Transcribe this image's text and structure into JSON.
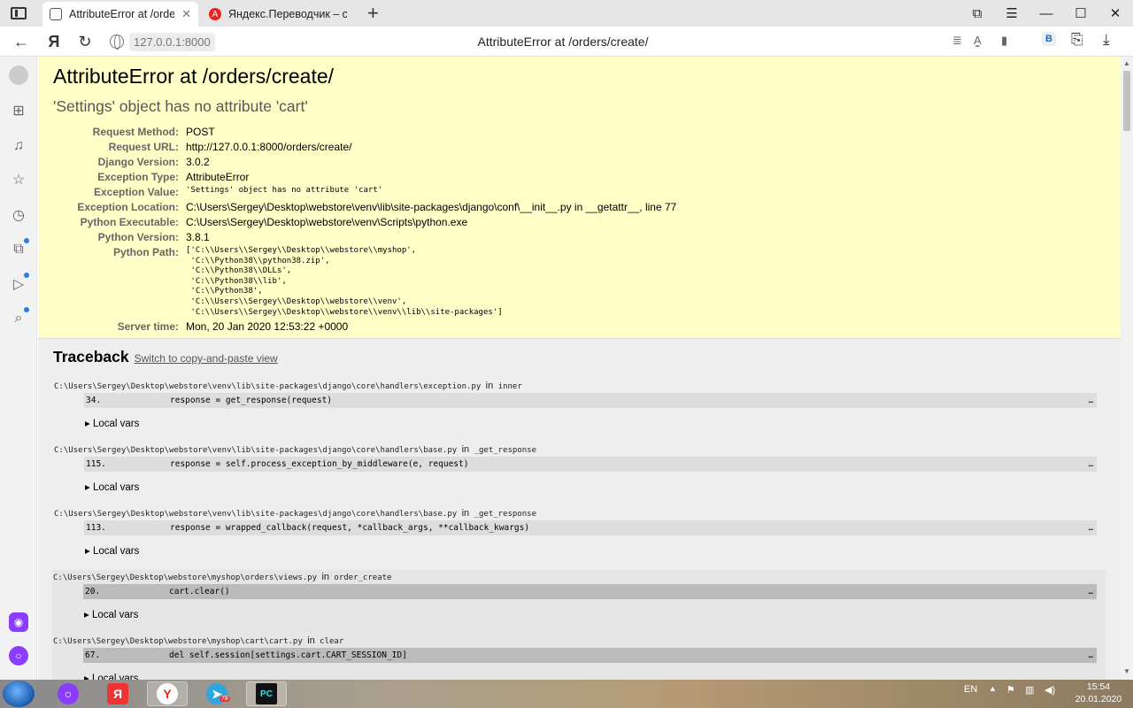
{
  "browser": {
    "tabs": [
      {
        "title": "AttributeError at /orders/",
        "active": true
      },
      {
        "title": "Яндекс.Переводчик – слов",
        "active": false
      }
    ],
    "url_host": "127.0.0.1:8000",
    "page_title": "AttributeError at /orders/create/"
  },
  "error": {
    "title": "AttributeError at /orders/create/",
    "subtitle": "'Settings' object has no attribute 'cart'",
    "meta": [
      {
        "label": "Request Method:",
        "value": "POST"
      },
      {
        "label": "Request URL:",
        "value": "http://127.0.0.1:8000/orders/create/"
      },
      {
        "label": "Django Version:",
        "value": "3.0.2"
      },
      {
        "label": "Exception Type:",
        "value": "AttributeError"
      },
      {
        "label": "Exception Value:",
        "value": "'Settings' object has no attribute 'cart'"
      },
      {
        "label": "Exception Location:",
        "value": "C:\\Users\\Sergey\\Desktop\\webstore\\venv\\lib\\site-packages\\django\\conf\\__init__.py in __getattr__, line 77"
      },
      {
        "label": "Python Executable:",
        "value": "C:\\Users\\Sergey\\Desktop\\webstore\\venv\\Scripts\\python.exe"
      },
      {
        "label": "Python Version:",
        "value": "3.8.1"
      },
      {
        "label": "Python Path:",
        "value": "['C:\\\\Users\\\\Sergey\\\\Desktop\\\\webstore\\\\myshop',\n 'C:\\\\Python38\\\\python38.zip',\n 'C:\\\\Python38\\\\DLLs',\n 'C:\\\\Python38\\\\lib',\n 'C:\\\\Python38',\n 'C:\\\\Users\\\\Sergey\\\\Desktop\\\\webstore\\\\venv',\n 'C:\\\\Users\\\\Sergey\\\\Desktop\\\\webstore\\\\venv\\\\lib\\\\site-packages']"
      },
      {
        "label": "Server time:",
        "value": "Mon, 20 Jan 2020 12:53:22 +0000"
      }
    ]
  },
  "traceback": {
    "heading": "Traceback",
    "switch_link": "Switch to copy-and-paste view",
    "in_word": "in",
    "local_vars": "▸ Local vars",
    "ellipsis": "…",
    "frames": [
      {
        "path": "C:\\Users\\Sergey\\Desktop\\webstore\\venv\\lib\\site-packages\\django\\core\\handlers\\exception.py",
        "func": "inner",
        "line": "34.",
        "code": "response = get_response(request)"
      },
      {
        "path": "C:\\Users\\Sergey\\Desktop\\webstore\\venv\\lib\\site-packages\\django\\core\\handlers\\base.py",
        "func": "_get_response",
        "line": "115.",
        "code": "response = self.process_exception_by_middleware(e, request)"
      },
      {
        "path": "C:\\Users\\Sergey\\Desktop\\webstore\\venv\\lib\\site-packages\\django\\core\\handlers\\base.py",
        "func": "_get_response",
        "line": "113.",
        "code": "response = wrapped_callback(request, *callback_args, **callback_kwargs)"
      },
      {
        "path": "C:\\Users\\Sergey\\Desktop\\webstore\\myshop\\orders\\views.py",
        "func": "order_create",
        "line": "20.",
        "code": "cart.clear()"
      },
      {
        "path": "C:\\Users\\Sergey\\Desktop\\webstore\\myshop\\cart\\cart.py",
        "func": "clear",
        "line": "67.",
        "code": "del self.session[settings.cart.CART_SESSION_ID]"
      }
    ]
  },
  "taskbar": {
    "language": "EN",
    "time": "15:54",
    "date": "20.01.2020",
    "telegram_badge": "78"
  }
}
